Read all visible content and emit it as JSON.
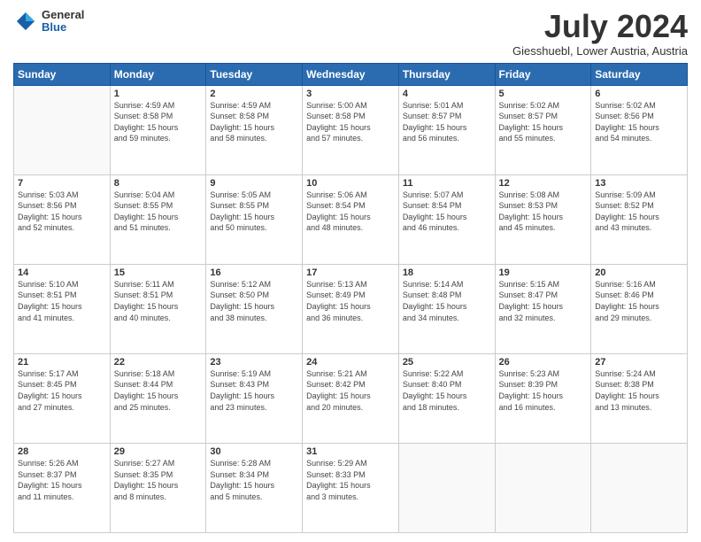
{
  "header": {
    "logo_general": "General",
    "logo_blue": "Blue",
    "month_title": "July 2024",
    "location": "Giesshuebl, Lower Austria, Austria"
  },
  "weekdays": [
    "Sunday",
    "Monday",
    "Tuesday",
    "Wednesday",
    "Thursday",
    "Friday",
    "Saturday"
  ],
  "weeks": [
    [
      {
        "day": "",
        "info": ""
      },
      {
        "day": "1",
        "info": "Sunrise: 4:59 AM\nSunset: 8:58 PM\nDaylight: 15 hours\nand 59 minutes."
      },
      {
        "day": "2",
        "info": "Sunrise: 4:59 AM\nSunset: 8:58 PM\nDaylight: 15 hours\nand 58 minutes."
      },
      {
        "day": "3",
        "info": "Sunrise: 5:00 AM\nSunset: 8:58 PM\nDaylight: 15 hours\nand 57 minutes."
      },
      {
        "day": "4",
        "info": "Sunrise: 5:01 AM\nSunset: 8:57 PM\nDaylight: 15 hours\nand 56 minutes."
      },
      {
        "day": "5",
        "info": "Sunrise: 5:02 AM\nSunset: 8:57 PM\nDaylight: 15 hours\nand 55 minutes."
      },
      {
        "day": "6",
        "info": "Sunrise: 5:02 AM\nSunset: 8:56 PM\nDaylight: 15 hours\nand 54 minutes."
      }
    ],
    [
      {
        "day": "7",
        "info": "Sunrise: 5:03 AM\nSunset: 8:56 PM\nDaylight: 15 hours\nand 52 minutes."
      },
      {
        "day": "8",
        "info": "Sunrise: 5:04 AM\nSunset: 8:55 PM\nDaylight: 15 hours\nand 51 minutes."
      },
      {
        "day": "9",
        "info": "Sunrise: 5:05 AM\nSunset: 8:55 PM\nDaylight: 15 hours\nand 50 minutes."
      },
      {
        "day": "10",
        "info": "Sunrise: 5:06 AM\nSunset: 8:54 PM\nDaylight: 15 hours\nand 48 minutes."
      },
      {
        "day": "11",
        "info": "Sunrise: 5:07 AM\nSunset: 8:54 PM\nDaylight: 15 hours\nand 46 minutes."
      },
      {
        "day": "12",
        "info": "Sunrise: 5:08 AM\nSunset: 8:53 PM\nDaylight: 15 hours\nand 45 minutes."
      },
      {
        "day": "13",
        "info": "Sunrise: 5:09 AM\nSunset: 8:52 PM\nDaylight: 15 hours\nand 43 minutes."
      }
    ],
    [
      {
        "day": "14",
        "info": "Sunrise: 5:10 AM\nSunset: 8:51 PM\nDaylight: 15 hours\nand 41 minutes."
      },
      {
        "day": "15",
        "info": "Sunrise: 5:11 AM\nSunset: 8:51 PM\nDaylight: 15 hours\nand 40 minutes."
      },
      {
        "day": "16",
        "info": "Sunrise: 5:12 AM\nSunset: 8:50 PM\nDaylight: 15 hours\nand 38 minutes."
      },
      {
        "day": "17",
        "info": "Sunrise: 5:13 AM\nSunset: 8:49 PM\nDaylight: 15 hours\nand 36 minutes."
      },
      {
        "day": "18",
        "info": "Sunrise: 5:14 AM\nSunset: 8:48 PM\nDaylight: 15 hours\nand 34 minutes."
      },
      {
        "day": "19",
        "info": "Sunrise: 5:15 AM\nSunset: 8:47 PM\nDaylight: 15 hours\nand 32 minutes."
      },
      {
        "day": "20",
        "info": "Sunrise: 5:16 AM\nSunset: 8:46 PM\nDaylight: 15 hours\nand 29 minutes."
      }
    ],
    [
      {
        "day": "21",
        "info": "Sunrise: 5:17 AM\nSunset: 8:45 PM\nDaylight: 15 hours\nand 27 minutes."
      },
      {
        "day": "22",
        "info": "Sunrise: 5:18 AM\nSunset: 8:44 PM\nDaylight: 15 hours\nand 25 minutes."
      },
      {
        "day": "23",
        "info": "Sunrise: 5:19 AM\nSunset: 8:43 PM\nDaylight: 15 hours\nand 23 minutes."
      },
      {
        "day": "24",
        "info": "Sunrise: 5:21 AM\nSunset: 8:42 PM\nDaylight: 15 hours\nand 20 minutes."
      },
      {
        "day": "25",
        "info": "Sunrise: 5:22 AM\nSunset: 8:40 PM\nDaylight: 15 hours\nand 18 minutes."
      },
      {
        "day": "26",
        "info": "Sunrise: 5:23 AM\nSunset: 8:39 PM\nDaylight: 15 hours\nand 16 minutes."
      },
      {
        "day": "27",
        "info": "Sunrise: 5:24 AM\nSunset: 8:38 PM\nDaylight: 15 hours\nand 13 minutes."
      }
    ],
    [
      {
        "day": "28",
        "info": "Sunrise: 5:26 AM\nSunset: 8:37 PM\nDaylight: 15 hours\nand 11 minutes."
      },
      {
        "day": "29",
        "info": "Sunrise: 5:27 AM\nSunset: 8:35 PM\nDaylight: 15 hours\nand 8 minutes."
      },
      {
        "day": "30",
        "info": "Sunrise: 5:28 AM\nSunset: 8:34 PM\nDaylight: 15 hours\nand 5 minutes."
      },
      {
        "day": "31",
        "info": "Sunrise: 5:29 AM\nSunset: 8:33 PM\nDaylight: 15 hours\nand 3 minutes."
      },
      {
        "day": "",
        "info": ""
      },
      {
        "day": "",
        "info": ""
      },
      {
        "day": "",
        "info": ""
      }
    ]
  ]
}
